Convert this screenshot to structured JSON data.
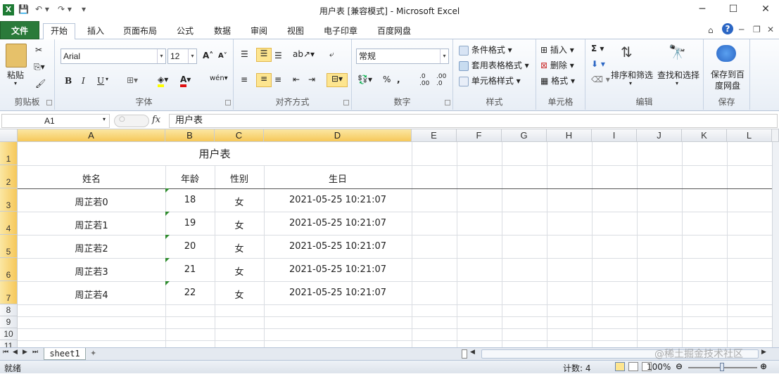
{
  "titlebar": {
    "title": "用户表  [兼容模式]  -  Microsoft Excel",
    "minimize": "─",
    "maximize": "☐",
    "close": "✕"
  },
  "tabs": {
    "file": "文件",
    "items": [
      "开始",
      "插入",
      "页面布局",
      "公式",
      "数据",
      "审阅",
      "视图",
      "电子印章",
      "百度网盘"
    ]
  },
  "ribbon": {
    "clipboard": {
      "label": "剪贴板",
      "paste": "粘贴"
    },
    "font": {
      "label": "字体",
      "name": "Arial",
      "size": "12",
      "bold": "B",
      "italic": "I",
      "underline": "U"
    },
    "alignment": {
      "label": "对齐方式"
    },
    "number": {
      "label": "数字",
      "format": "常规"
    },
    "styles": {
      "label": "样式",
      "conditional": "条件格式",
      "table": "套用表格格式",
      "cell": "单元格样式"
    },
    "cells": {
      "label": "单元格",
      "insert": "插入",
      "delete": "删除",
      "format": "格式"
    },
    "editing": {
      "label": "编辑",
      "sort": "排序和筛选",
      "find": "查找和选择"
    },
    "save": {
      "label": "保存",
      "button": "保存到百度网盘"
    }
  },
  "formula_bar": {
    "name_box": "A1",
    "fx": "fx",
    "content": "用户表"
  },
  "columns": [
    "A",
    "B",
    "C",
    "D",
    "E",
    "F",
    "G",
    "H",
    "I",
    "J",
    "K",
    "L"
  ],
  "rows": [
    "1",
    "2",
    "3",
    "4",
    "5",
    "6",
    "7",
    "8",
    "9",
    "10",
    "11"
  ],
  "sheet": {
    "title": "用户表",
    "headers": [
      "姓名",
      "年龄",
      "性别",
      "生日"
    ],
    "data": [
      [
        "周芷若0",
        "18",
        "女",
        "2021-05-25 10:21:07"
      ],
      [
        "周芷若1",
        "19",
        "女",
        "2021-05-25 10:21:07"
      ],
      [
        "周芷若2",
        "20",
        "女",
        "2021-05-25 10:21:07"
      ],
      [
        "周芷若3",
        "21",
        "女",
        "2021-05-25 10:21:07"
      ],
      [
        "周芷若4",
        "22",
        "女",
        "2021-05-25 10:21:07"
      ]
    ]
  },
  "sheet_tabs": {
    "active": "sheet1"
  },
  "status": {
    "mode": "就绪",
    "count": "计数: 4",
    "zoom": "100%",
    "watermark": "@稀土掘金技术社区"
  }
}
